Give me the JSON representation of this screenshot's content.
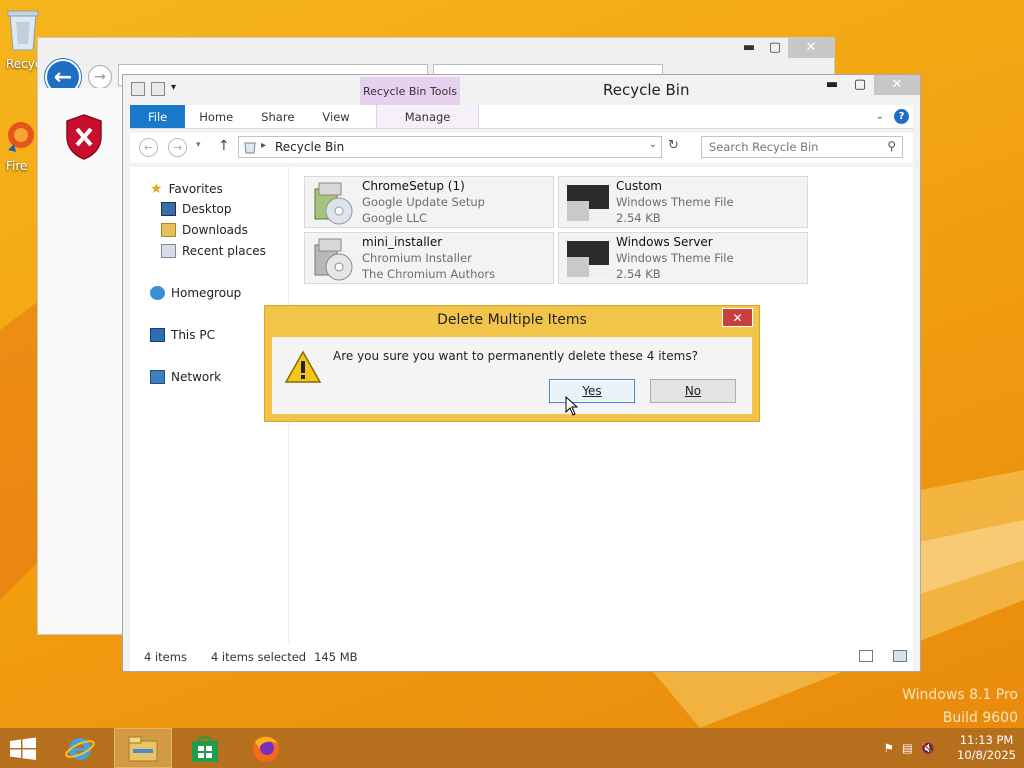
{
  "desktop": {
    "icons": [
      {
        "label": "Recyc",
        "icon": "recycle-bin-icon"
      },
      {
        "label": "Fire",
        "icon": "firefox-icon"
      }
    ],
    "watermark": {
      "line1": "Windows 8.1 Pro",
      "line2": "Build 9600"
    }
  },
  "browser": {
    "caption": {
      "minimize": "▬",
      "maximize": "▢",
      "close": "✕"
    }
  },
  "explorer": {
    "title": "Recycle Bin",
    "context_tab": "Recycle Bin Tools",
    "ribbon_tabs": [
      {
        "label": "File"
      },
      {
        "label": "Home"
      },
      {
        "label": "Share"
      },
      {
        "label": "View"
      },
      {
        "label": "Manage"
      }
    ],
    "caption": {
      "minimize": "▬",
      "maximize": "▢",
      "close": "✕"
    },
    "address": {
      "path": "Recycle Bin"
    },
    "search": {
      "placeholder": "Search Recycle Bin"
    },
    "nav_pane": {
      "favorites": "Favorites",
      "items": [
        "Desktop",
        "Downloads",
        "Recent places"
      ],
      "homegroup": "Homegroup",
      "this_pc": "This PC",
      "network": "Network"
    },
    "files": [
      {
        "name": "ChromeSetup (1)",
        "line2": "Google Update Setup",
        "line3": "Google LLC",
        "icon": "installer-icon"
      },
      {
        "name": "Custom",
        "line2": "Windows Theme File",
        "line3": "2.54 KB",
        "icon": "theme-file-icon"
      },
      {
        "name": "mini_installer",
        "line2": "Chromium Installer",
        "line3": "The Chromium Authors",
        "icon": "installer-icon"
      },
      {
        "name": "Windows Server",
        "line2": "Windows Theme File",
        "line3": "2.54 KB",
        "icon": "theme-file-icon"
      }
    ],
    "status": {
      "count": "4 items",
      "selected": "4 items selected",
      "size": "145 MB"
    }
  },
  "dialog": {
    "title": "Delete Multiple Items",
    "message": "Are you sure you want to permanently delete these 4 items?",
    "yes": "Yes",
    "no": "No",
    "close": "✕"
  },
  "taskbar": {
    "apps": [
      "internet-explorer-icon",
      "file-explorer-icon",
      "store-icon",
      "firefox-icon"
    ],
    "time": "11:13 PM",
    "date": "10/8/2025"
  }
}
